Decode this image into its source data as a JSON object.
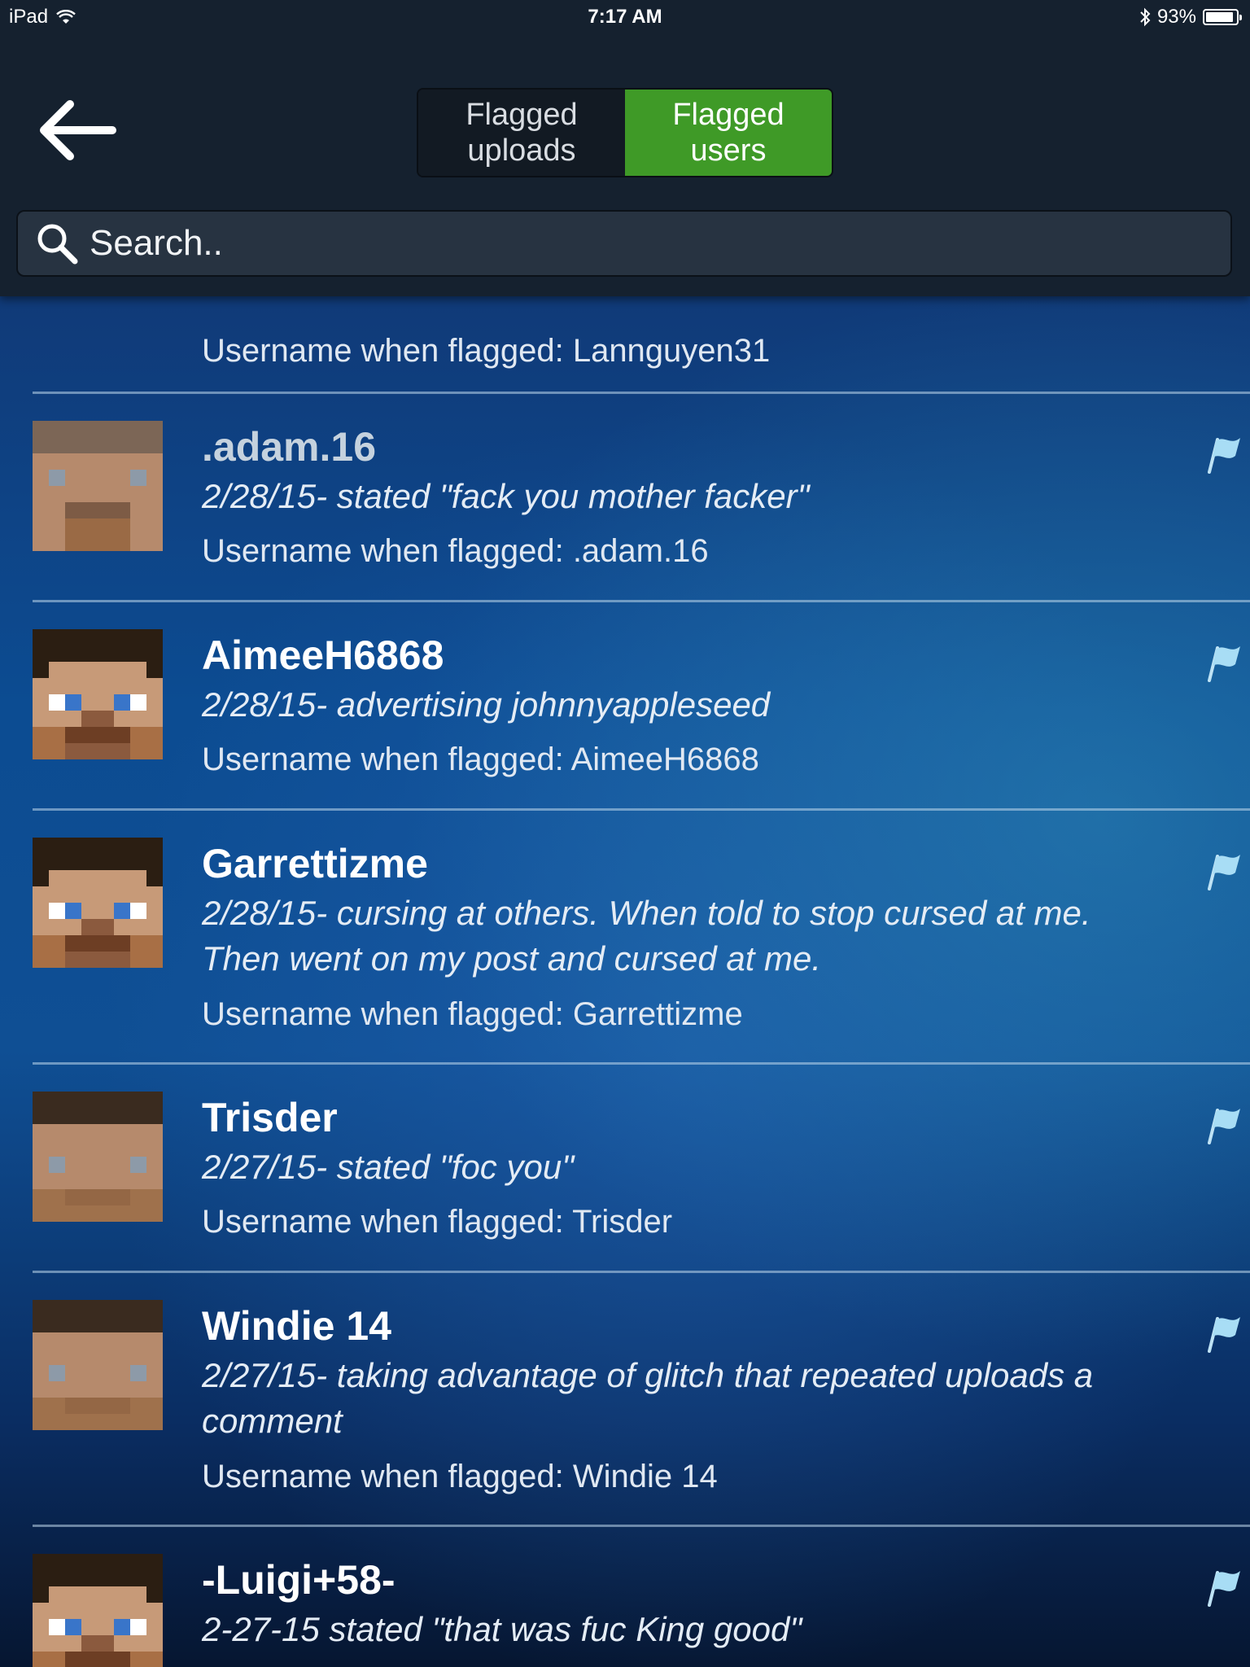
{
  "status_bar": {
    "device": "iPad",
    "time": "7:17 AM",
    "battery": "93%",
    "battery_level": 0.93
  },
  "header": {
    "tabs": [
      {
        "label": "Flagged\nuploads",
        "active": false
      },
      {
        "label": "Flagged\nusers",
        "active": true
      }
    ],
    "accent_color": "#3f9a27"
  },
  "search": {
    "placeholder": "Search.."
  },
  "entries": [
    {
      "username": "",
      "reason": "",
      "flagged_as": "Username when flagged: Lannguyen31",
      "avatar_eyes": "none",
      "partial": true
    },
    {
      "username": ".adam.16",
      "reason": "2/28/15- stated \"fack you mother facker\"",
      "flagged_as": "Username when flagged: .adam.16",
      "avatar_eyes": "grey"
    },
    {
      "username": "AimeeH6868",
      "reason": "2/28/15- advertising johnnyappleseed",
      "flagged_as": "Username when flagged: AimeeH6868",
      "avatar_eyes": "blue"
    },
    {
      "username": "Garrettizme",
      "reason": "2/28/15- cursing at others. When told to stop cursed at me. Then went on my post and cursed at me.",
      "flagged_as": "Username when flagged: Garrettizme",
      "avatar_eyes": "blue"
    },
    {
      "username": "Trisder",
      "reason": "2/27/15- stated \"foc you\"",
      "flagged_as": "Username when flagged: Trisder",
      "avatar_eyes": "grey"
    },
    {
      "username": "Windie 14",
      "reason": "2/27/15- taking advantage of glitch that repeated uploads a comment",
      "flagged_as": "Username when flagged: Windie 14",
      "avatar_eyes": "grey"
    },
    {
      "username": "-Luigi+58-",
      "reason": "2-27-15 stated \"that was fuc King good\"",
      "flagged_as": "",
      "avatar_eyes": "blue"
    }
  ]
}
